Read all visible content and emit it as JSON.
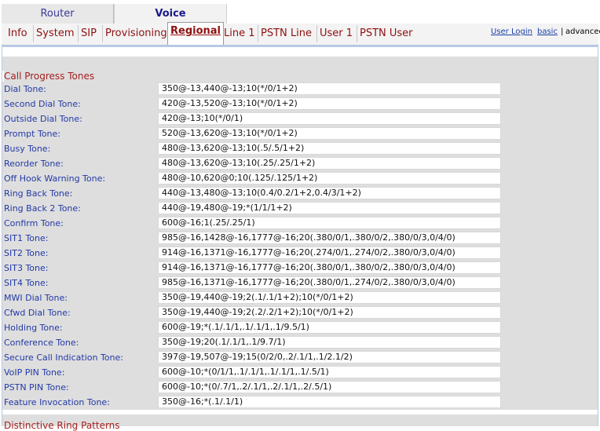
{
  "top_tabs": {
    "router": "Router",
    "voice": "Voice"
  },
  "sub_tabs": [
    "Info",
    "System",
    "SIP",
    "Provisioning",
    "Regional",
    "Line 1",
    "PSTN Line",
    "User 1",
    "PSTN User"
  ],
  "active_sub_tab": "Regional",
  "links": {
    "user_login": "User Login",
    "basic": "basic",
    "separator": "|",
    "advanced": "advanced"
  },
  "section": {
    "title": "Call Progress Tones",
    "rows": [
      {
        "label": "Dial Tone:",
        "value": "350@-13,440@-13;10(*/0/1+2)"
      },
      {
        "label": "Second Dial Tone:",
        "value": "420@-13,520@-13;10(*/0/1+2)"
      },
      {
        "label": "Outside Dial Tone:",
        "value": "420@-13;10(*/0/1)"
      },
      {
        "label": "Prompt Tone:",
        "value": "520@-13,620@-13;10(*/0/1+2)"
      },
      {
        "label": "Busy Tone:",
        "value": "480@-13,620@-13;10(.5/.5/1+2)"
      },
      {
        "label": "Reorder Tone:",
        "value": "480@-13,620@-13;10(.25/.25/1+2)"
      },
      {
        "label": "Off Hook Warning Tone:",
        "value": "480@-10,620@0;10(.125/.125/1+2)"
      },
      {
        "label": "Ring Back Tone:",
        "value": "440@-13,480@-13;10(0.4/0.2/1+2,0.4/3/1+2)"
      },
      {
        "label": "Ring Back 2 Tone:",
        "value": "440@-19,480@-19;*(1/1/1+2)"
      },
      {
        "label": "Confirm Tone:",
        "value": "600@-16;1(.25/.25/1)"
      },
      {
        "label": "SIT1 Tone:",
        "value": "985@-16,1428@-16,1777@-16;20(.380/0/1,.380/0/2,.380/0/3,0/4/0)"
      },
      {
        "label": "SIT2 Tone:",
        "value": "914@-16,1371@-16,1777@-16;20(.274/0/1,.274/0/2,.380/0/3,0/4/0)"
      },
      {
        "label": "SIT3 Tone:",
        "value": "914@-16,1371@-16,1777@-16;20(.380/0/1,.380/0/2,.380/0/3,0/4/0)"
      },
      {
        "label": "SIT4 Tone:",
        "value": "985@-16,1371@-16,1777@-16;20(.380/0/1,.274/0/2,.380/0/3,0/4/0)"
      },
      {
        "label": "MWI Dial Tone:",
        "value": "350@-19,440@-19;2(.1/.1/1+2);10(*/0/1+2)"
      },
      {
        "label": "Cfwd Dial Tone:",
        "value": "350@-19,440@-19;2(.2/.2/1+2);10(*/0/1+2)"
      },
      {
        "label": "Holding Tone:",
        "value": "600@-19;*(.1/.1/1,.1/.1/1,.1/9.5/1)"
      },
      {
        "label": "Conference Tone:",
        "value": "350@-19;20(.1/.1/1,.1/9.7/1)"
      },
      {
        "label": "Secure Call Indication Tone:",
        "value": "397@-19,507@-19;15(0/2/0,.2/.1/1,.1/2.1/2)"
      },
      {
        "label": "VoIP PIN Tone:",
        "value": "600@-10;*(0/1/1,.1/.1/1,.1/.1/1,.1/.5/1)"
      },
      {
        "label": "PSTN PIN Tone:",
        "value": "600@-10;*(0/.7/1,.2/.1/1,.2/.1/1,.2/.5/1)"
      },
      {
        "label": "Feature Invocation Tone:",
        "value": "350@-16;*(.1/.1/1)"
      }
    ]
  },
  "next_section_title": "Distinctive Ring Patterns"
}
